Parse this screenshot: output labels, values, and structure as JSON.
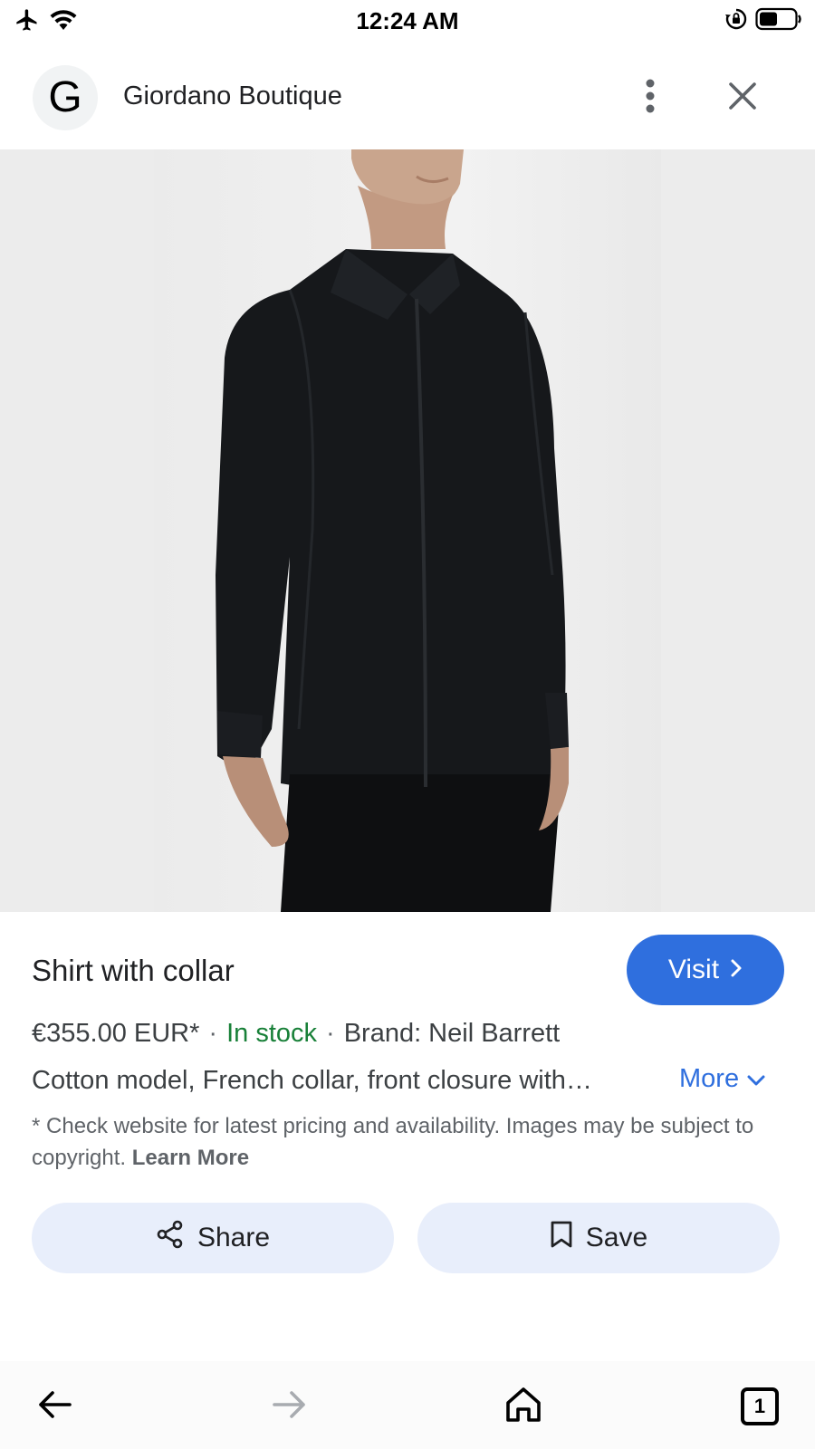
{
  "status_bar": {
    "time": "12:24 AM",
    "left_icons": [
      "airplane-icon",
      "wifi-icon"
    ],
    "right_icons": [
      "rotation-lock-icon",
      "battery-icon"
    ],
    "battery_level": 0.5
  },
  "header": {
    "logo_letter": "G",
    "site_name": "Giordano Boutique",
    "menu_icon": "more-vertical-icon",
    "close_icon": "close-icon"
  },
  "product": {
    "title": "Shirt with collar",
    "visit_label": "Visit",
    "price": "€355.00 EUR*",
    "separator": "·",
    "stock": "In stock",
    "brand": "Brand: Neil Barrett",
    "description": "Cotton model, French collar, front closure with…",
    "more_label": "More",
    "disclaimer": "* Check website for latest pricing and availability. Images may be subject to copyright.",
    "learn_more": "Learn More"
  },
  "actions": {
    "share_label": "Share",
    "save_label": "Save"
  },
  "bottom_nav": {
    "tab_count": "1",
    "icons": [
      "back-arrow-icon",
      "forward-arrow-icon",
      "home-icon",
      "tabs-icon"
    ]
  },
  "colors": {
    "accent": "#2f6fde",
    "in_stock": "#188038",
    "action_bg": "#e8eefb"
  }
}
